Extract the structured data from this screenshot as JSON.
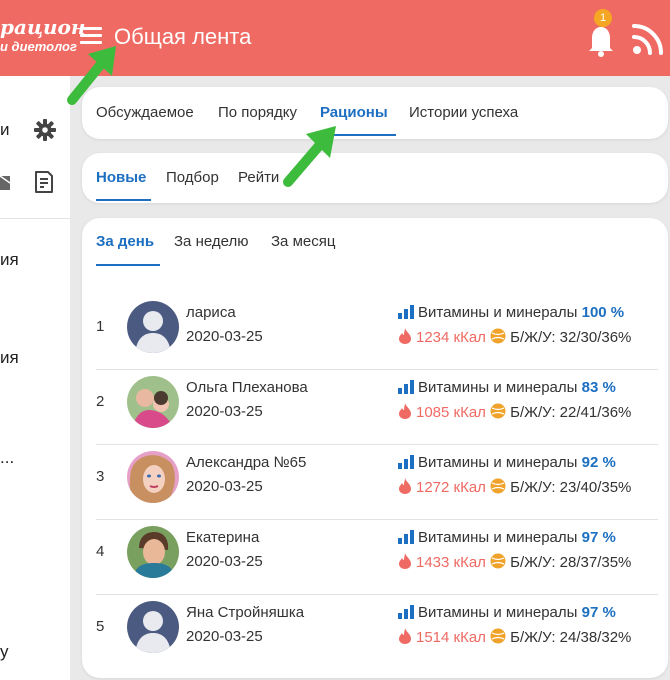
{
  "header": {
    "logo_line1": "рацион",
    "logo_line2": "и диетолог",
    "title": "Общая лента",
    "notification_count": "1",
    "colors": {
      "header_bg": "#ef6a63",
      "accent_blue": "#1c6fc1",
      "badge": "#f5a623"
    }
  },
  "sidebar": {
    "items": [
      {
        "label": "и"
      },
      {
        "label": "ия"
      },
      {
        "label": "ия"
      },
      {
        "label": "..."
      },
      {
        "label": "у"
      }
    ]
  },
  "tabs_main": [
    {
      "label": "Обсуждаемое",
      "active": false
    },
    {
      "label": "По порядку",
      "active": false
    },
    {
      "label": "Рационы",
      "active": true
    },
    {
      "label": "Истории успеха",
      "active": false
    }
  ],
  "tabs_sub": [
    {
      "label": "Новые",
      "active": true
    },
    {
      "label": "Подбор",
      "active": false
    },
    {
      "label": "Рейти",
      "active": false
    }
  ],
  "tabs_period": [
    {
      "label": "За день",
      "active": true
    },
    {
      "label": "За неделю",
      "active": false
    },
    {
      "label": "За месяц",
      "active": false
    }
  ],
  "rows": [
    {
      "rank": "1",
      "name": "лариса",
      "date": "2020-03-25",
      "vitamins_label": "Витамины и минералы",
      "percent": "100 %",
      "kcal": "1234 кКал",
      "bju": "Б/Ж/У: 32/30/36%"
    },
    {
      "rank": "2",
      "name": "Ольга Плеханова",
      "date": "2020-03-25",
      "vitamins_label": "Витамины и минералы",
      "percent": "83 %",
      "kcal": "1085 кКал",
      "bju": "Б/Ж/У: 22/41/36%"
    },
    {
      "rank": "3",
      "name": "Александра №65",
      "date": "2020-03-25",
      "vitamins_label": "Витамины и минералы",
      "percent": "92 %",
      "kcal": "1272 кКал",
      "bju": "Б/Ж/У: 23/40/35%"
    },
    {
      "rank": "4",
      "name": "Екатерина",
      "date": "2020-03-25",
      "vitamins_label": "Витамины и минералы",
      "percent": "97 %",
      "kcal": "1433 кКал",
      "bju": "Б/Ж/У: 28/37/35%"
    },
    {
      "rank": "5",
      "name": "Яна Стройняшка",
      "date": "2020-03-25",
      "vitamins_label": "Витамины и минералы",
      "percent": "97 %",
      "kcal": "1514 кКал",
      "bju": "Б/Ж/У: 24/38/32%"
    }
  ]
}
